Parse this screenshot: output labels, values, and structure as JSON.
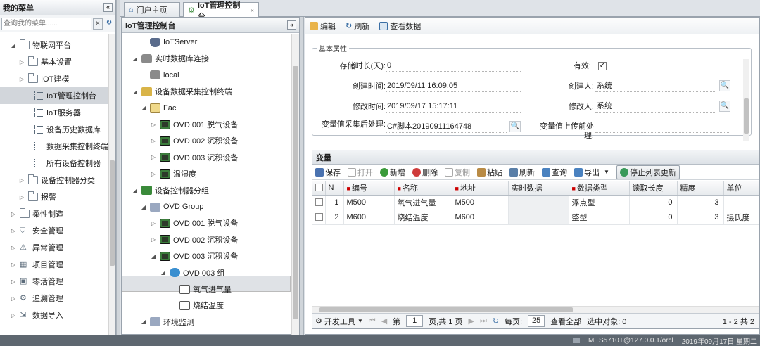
{
  "left_menu": {
    "title": "我的菜单",
    "collapse": "«",
    "search_placeholder": "查询我的菜单......",
    "search_clear": "×",
    "refresh_icon": "refresh-icon",
    "items": [
      {
        "label": "物联网平台",
        "arrow": "◢",
        "icon": "folder-icon"
      },
      {
        "label": "基本设置",
        "arrow": "▷",
        "icon": "folder-icon"
      },
      {
        "label": "IOT建模",
        "arrow": "▷",
        "icon": "folder-icon"
      },
      {
        "label": "IoT管理控制台",
        "arrow": "",
        "icon": "list-icon"
      },
      {
        "label": "IoT服务器",
        "arrow": "",
        "icon": "list-icon"
      },
      {
        "label": "设备历史数据库",
        "arrow": "",
        "icon": "list-icon"
      },
      {
        "label": "数据采集控制终端",
        "arrow": "",
        "icon": "list-icon"
      },
      {
        "label": "所有设备控制器",
        "arrow": "",
        "icon": "list-icon"
      },
      {
        "label": "设备控制器分类",
        "arrow": "▷",
        "icon": "folder-icon"
      },
      {
        "label": "报警",
        "arrow": "▷",
        "icon": "folder-icon"
      },
      {
        "label": "柔性制造",
        "arrow": "▷",
        "icon": "folder-icon"
      },
      {
        "label": "安全管理",
        "arrow": "▷",
        "icon": "shield-icon"
      },
      {
        "label": "异常管理",
        "arrow": "▷",
        "icon": "warning-icon"
      },
      {
        "label": "项目管理",
        "arrow": "▷",
        "icon": "calendar-icon"
      },
      {
        "label": "零活管理",
        "arrow": "▷",
        "icon": "briefcase-icon"
      },
      {
        "label": "追溯管理",
        "arrow": "▷",
        "icon": "gear-icon"
      },
      {
        "label": "数据导入",
        "arrow": "▷",
        "icon": "import-icon"
      }
    ]
  },
  "tabs": [
    {
      "label": "门户主页",
      "icon": "home-icon"
    },
    {
      "label": "IoT管理控制台",
      "icon": "iot-icon",
      "close": "×"
    }
  ],
  "tree": {
    "title": "IoT管理控制台",
    "collapse": "«",
    "nodes": [
      {
        "label": "IoTServer",
        "arrow": "",
        "icon": "shield-icon"
      },
      {
        "label": "实时数据库连接",
        "arrow": "◢",
        "icon": "database-icon"
      },
      {
        "label": "local",
        "arrow": "",
        "icon": "database-icon"
      },
      {
        "label": "设备数据采集控制终端",
        "arrow": "◢",
        "icon": "terminal-icon"
      },
      {
        "label": "Fac",
        "arrow": "◢",
        "icon": "factory-icon"
      },
      {
        "label": "OVD 001 脱气设备",
        "arrow": "▷",
        "icon": "device-icon"
      },
      {
        "label": "OVD 002 沉积设备",
        "arrow": "▷",
        "icon": "device-icon"
      },
      {
        "label": "OVD 003 沉积设备",
        "arrow": "▷",
        "icon": "device-icon"
      },
      {
        "label": "温湿度",
        "arrow": "▷",
        "icon": "device-icon"
      },
      {
        "label": "设备控制器分组",
        "arrow": "◢",
        "icon": "group-icon"
      },
      {
        "label": "OVD Group",
        "arrow": "◢",
        "icon": "network-icon"
      },
      {
        "label": "OVD 001 脱气设备",
        "arrow": "▷",
        "icon": "device-icon"
      },
      {
        "label": "OVD 002 沉积设备",
        "arrow": "▷",
        "icon": "device-icon"
      },
      {
        "label": "OVD 003 沉积设备",
        "arrow": "◢",
        "icon": "device-icon"
      },
      {
        "label": "OVD 003 组",
        "arrow": "◢",
        "icon": "cluster-icon"
      },
      {
        "label": "氧气进气量",
        "arrow": "",
        "icon": "variable-icon"
      },
      {
        "label": "烧结温度",
        "arrow": "",
        "icon": "variable-icon"
      },
      {
        "label": "环境监测",
        "arrow": "◢",
        "icon": "network-icon"
      }
    ]
  },
  "toolbar": {
    "edit": "编辑",
    "refresh": "刷新",
    "view_data": "查看数据"
  },
  "basic": {
    "legend": "基本属性",
    "storage_label": "存储时长(天):",
    "storage_value": "0",
    "valid_label": "有效:",
    "valid_checked": "✓",
    "created_time_label": "创建时间:",
    "created_time_value": "2019/09/11 16:09:05",
    "creator_label": "创建人:",
    "creator_value": "系统",
    "modified_time_label": "修改时间:",
    "modified_time_value": "2019/09/17 15:17:11",
    "modifier_label": "修改人:",
    "modifier_value": "系统",
    "post_label": "变量值采集后处理:",
    "post_value": "C#脚本20190911164748",
    "pre_label": "变量值上传前处理:",
    "pre_value": ""
  },
  "variables": {
    "title": "变量",
    "toolbar": {
      "save": "保存",
      "open": "打开",
      "add": "新增",
      "delete": "删除",
      "copy": "复制",
      "paste": "粘贴",
      "refresh": "刷新",
      "query": "查询",
      "export": "导出",
      "stop": "停止列表更新"
    },
    "columns": [
      "",
      "",
      "编号",
      "名称",
      "地址",
      "实时数据",
      "数据类型",
      "读取长度",
      "精度",
      "单位"
    ],
    "rows": [
      {
        "num": "1",
        "code": "M500",
        "name": "氧气进气量",
        "address": "M500",
        "realtime": "",
        "type": "浮点型",
        "length": "0",
        "precision": "3",
        "unit": ""
      },
      {
        "num": "2",
        "code": "M600",
        "name": "烧结温度",
        "address": "M600",
        "realtime": "",
        "type": "整型",
        "length": "0",
        "precision": "3",
        "unit": "摄氏度"
      }
    ],
    "pager": {
      "dev_tools": "开发工具",
      "page_label": "第",
      "page_value": "1",
      "page_total": "页,共 1 页",
      "per_page_label": "每页:",
      "per_page_value": "25",
      "view_all": "查看全部",
      "selected": "选中对象: 0",
      "range": "1 - 2 共 2"
    }
  },
  "status": {
    "connection": "MES5710T@127.0.0.1/orcl",
    "date": "2019年09月17日 星期二"
  }
}
